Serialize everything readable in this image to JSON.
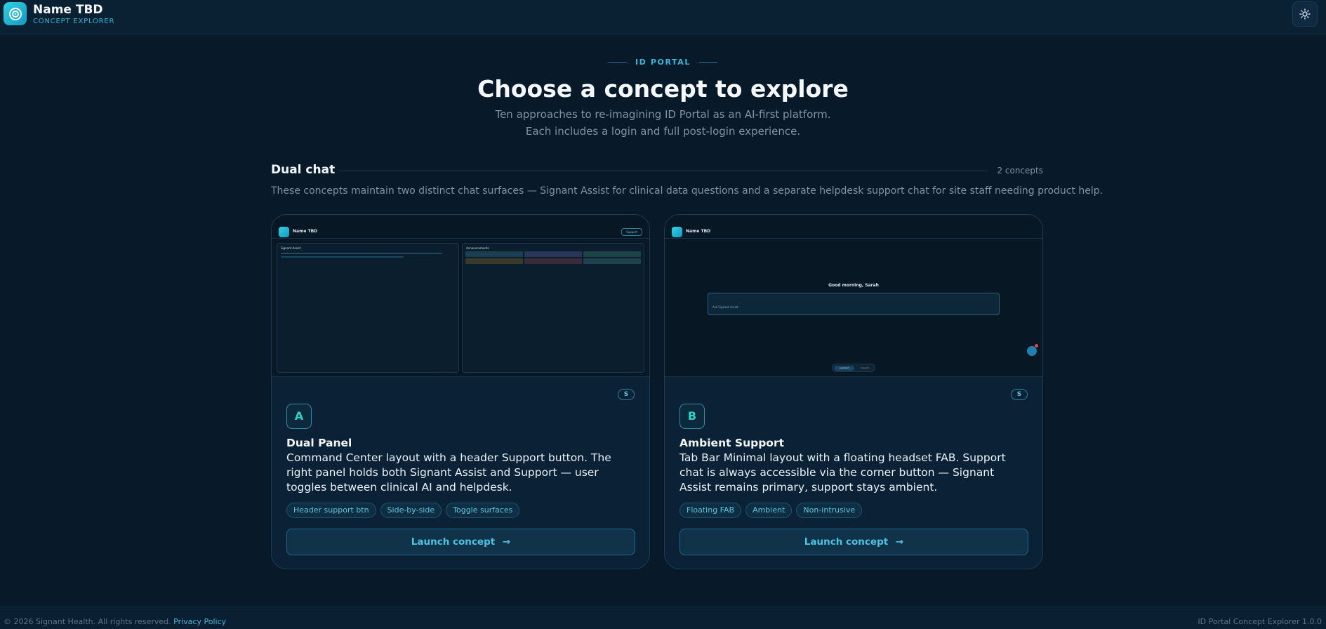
{
  "header": {
    "brand_name": "Name TBD",
    "brand_sub": "CONCEPT EXPLORER",
    "logo_icon": "spiral-icon",
    "theme_icon": "sun-icon"
  },
  "hero": {
    "eyebrow": "ID PORTAL",
    "title": "Choose a concept to explore",
    "subtitle_line1": "Ten approaches to re-imagining ID Portal as an AI-first platform.",
    "subtitle_line2": "Each includes a login and full post-login experience."
  },
  "section": {
    "title": "Dual chat",
    "count": "2 concepts",
    "description": "These concepts maintain two distinct chat surfaces — Signant Assist for clinical data questions and a separate helpdesk support chat for site staff needing product help."
  },
  "cards": [
    {
      "preview": {
        "brand": "Name TBD",
        "support_btn": "Support",
        "left_panel_title": "Signant Assist",
        "right_panel_title": "Announcements"
      },
      "badge": "S",
      "letter": "A",
      "title": "Dual Panel",
      "description": "Command Center layout with a header Support button. The right panel holds both Signant Assist and Support — user toggles between clinical AI and helpdesk.",
      "chips": [
        "Header support btn",
        "Side-by-side",
        "Toggle surfaces"
      ],
      "launch_label": "Launch concept"
    },
    {
      "preview": {
        "brand": "Name TBD",
        "greeting": "Good morning, Sarah",
        "ask_placeholder": "Ask Signant Assist",
        "tab1": "Assistant",
        "tab2": "Support"
      },
      "badge": "S",
      "letter": "B",
      "title": "Ambient Support",
      "description": "Tab Bar Minimal layout with a floating headset FAB. Support chat is always accessible via the corner button — Signant Assist remains primary, support stays ambient.",
      "chips": [
        "Floating FAB",
        "Ambient",
        "Non-intrusive"
      ],
      "launch_label": "Launch concept"
    }
  ],
  "footer": {
    "copyright": "© 2026 Signant Health. All rights reserved.",
    "privacy": "Privacy Policy",
    "version": "ID Portal Concept Explorer 1.0.0"
  },
  "colors": {
    "background": "#081a29",
    "accent": "#2fb4d6",
    "card": "#0b2236"
  }
}
